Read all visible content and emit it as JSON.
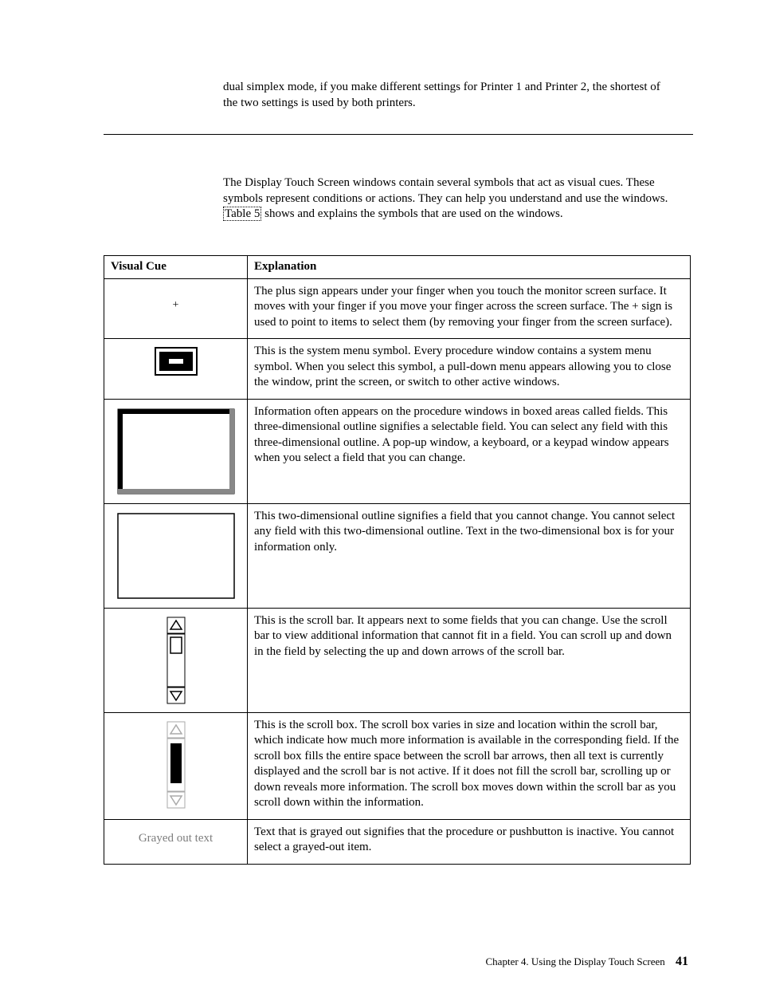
{
  "intro_top": "dual simplex mode, if you make different settings for Printer 1 and Printer 2, the shortest of the two settings is used by both printers.",
  "intro_mid_a": "The Display Touch Screen windows contain several symbols that act as visual cues. These symbols represent conditions or actions. They can help you understand and use the windows. ",
  "intro_mid_link": "Table 5",
  "intro_mid_b": " shows and explains the symbols that are used on the windows.",
  "table": {
    "headers": {
      "cue": "Visual Cue",
      "exp": "Explanation"
    },
    "rows": [
      {
        "cue_kind": "plus",
        "cue_text": "+",
        "explanation": "The plus sign appears under your finger when you touch the monitor screen surface. It moves with your finger if you move your finger across the screen surface. The + sign is used to point to items to select them (by removing your finger from the screen surface)."
      },
      {
        "cue_kind": "sysmenu",
        "explanation": "This is the system menu symbol. Every procedure window contains a system menu symbol. When you select this symbol, a pull-down menu appears allowing you to close the window, print the screen, or switch to other active windows."
      },
      {
        "cue_kind": "field3d",
        "explanation": "Information often appears on the procedure windows in boxed areas called fields. This three-dimensional outline signifies a selectable field. You can select any field with this three-dimensional outline. A pop-up window, a keyboard, or a keypad window appears when you select a field that you can change."
      },
      {
        "cue_kind": "field2d",
        "explanation": "This two-dimensional outline signifies a field that you cannot change. You cannot select any field with this two-dimensional outline. Text in the two-dimensional box is for your information only."
      },
      {
        "cue_kind": "scrollbar",
        "explanation": "This is the scroll bar. It appears next to some fields that you can change. Use the scroll bar to view additional information that cannot fit in a field. You can scroll up and down in the field by selecting the up and down arrows of the scroll bar."
      },
      {
        "cue_kind": "scrollbox",
        "explanation": "This is the scroll box. The scroll box varies in size and location within the scroll bar, which indicate how much more information is available in the corresponding field. If the scroll box fills the entire space between the scroll bar arrows, then all text is currently displayed and the scroll bar is not active. If it does not fill the scroll bar, scrolling up or down reveals more information. The scroll box moves down within the scroll bar as you scroll down within the information."
      },
      {
        "cue_kind": "grayed",
        "cue_text": "Grayed out text",
        "explanation": "Text that is grayed out signifies that the procedure or pushbutton is inactive. You cannot select a grayed-out item."
      }
    ]
  },
  "footer": {
    "chapter": "Chapter 4. Using the Display Touch Screen",
    "page": "41"
  }
}
